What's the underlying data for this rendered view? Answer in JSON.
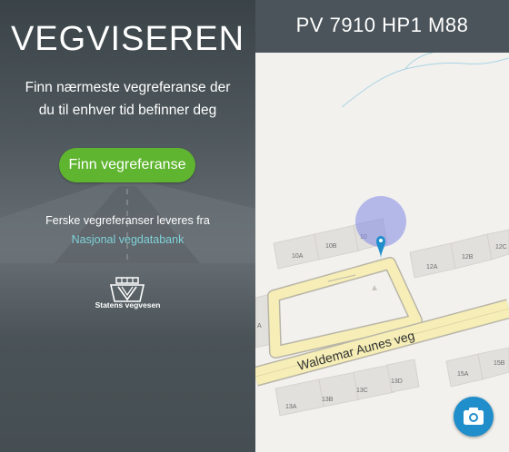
{
  "hero": {
    "title": "VEGVISEREN",
    "subtitle": "Finn nærmeste vegreferanse der du til enhver tid befinner deg",
    "button_label": "Finn vegreferanse",
    "note_text": "Ferske vegreferanser leveres fra",
    "note_link": "Nasjonal vegdatabank",
    "logo_text": "Statens vegvesen"
  },
  "reference": {
    "text": "PV 7910 HP1 M88"
  },
  "map": {
    "road_name": "Waldemar Aunes veg",
    "building_labels": [
      "10A",
      "10B",
      "10",
      "12A",
      "12B",
      "12C",
      "13A",
      "13B",
      "13C",
      "13D",
      "15A",
      "15B",
      "A"
    ],
    "marker_icon": "map-pin-icon",
    "accuracy_color": "#7f88e6"
  },
  "camera_button": {
    "icon": "camera-icon",
    "color": "#1f8ecb"
  }
}
